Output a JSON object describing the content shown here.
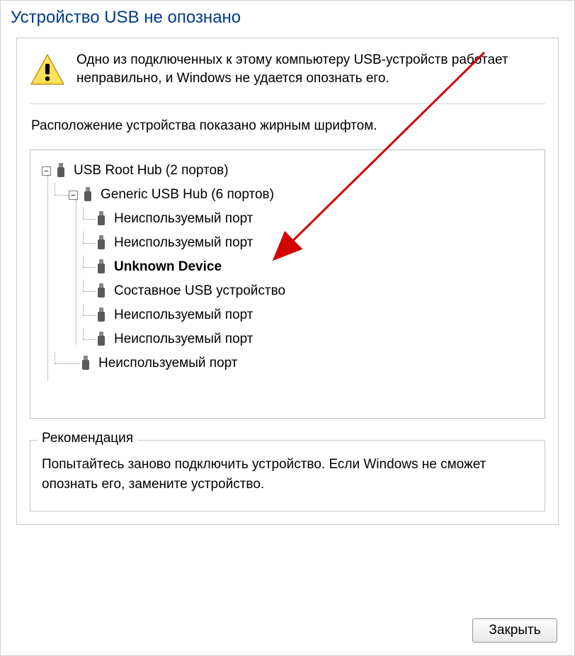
{
  "title": "Устройство USB не опознано",
  "message": "Одно из подключенных к этому компьютеру USB-устройств работает неправильно, и Windows не удается опознать его.",
  "location_label": "Расположение устройства показано жирным шрифтом.",
  "tree": {
    "root": "USB Root Hub (2 портов)",
    "hub": "Generic USB Hub (6 портов)",
    "ports": [
      "Неиспользуемый порт",
      "Неиспользуемый порт",
      "Unknown Device",
      "Составное USB устройство",
      "Неиспользуемый порт",
      "Неиспользуемый порт"
    ],
    "last_port": "Неиспользуемый порт"
  },
  "recommendation": {
    "legend": "Рекомендация",
    "text": "Попытайтесь заново подключить устройство. Если Windows не сможет опознать его, замените устройство."
  },
  "close_button": "Закрыть"
}
